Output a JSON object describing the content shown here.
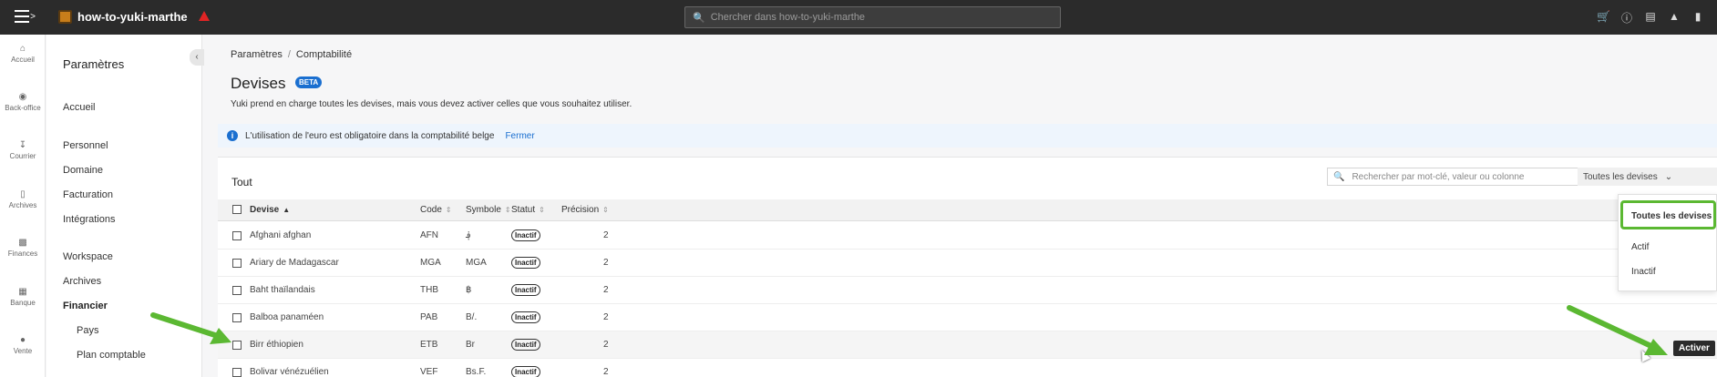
{
  "topbar": {
    "app_name": "how-to-yuki-marthe",
    "search_placeholder": "Chercher dans how-to-yuki-marthe",
    "icons": [
      "cart-icon",
      "info-icon",
      "gift-icon",
      "megaphone-icon",
      "bookmark-icon"
    ],
    "cart_color": "#f08c1a"
  },
  "rail": {
    "items": [
      {
        "label": "Accueil",
        "icon": "home-icon"
      },
      {
        "label": "Back-office",
        "icon": "back-office-icon"
      },
      {
        "label": "Courrier",
        "icon": "inbox-icon"
      },
      {
        "label": "Archives",
        "icon": "archive-icon"
      },
      {
        "label": "Finances",
        "icon": "chart-icon"
      },
      {
        "label": "Banque",
        "icon": "bank-icon"
      },
      {
        "label": "Vente",
        "icon": "sale-icon"
      }
    ]
  },
  "sidebar": {
    "title": "Paramètres",
    "items": [
      {
        "label": "Accueil"
      },
      {
        "label": "Personnel"
      },
      {
        "label": "Domaine"
      },
      {
        "label": "Facturation"
      },
      {
        "label": "Intégrations"
      },
      {
        "label": "Workspace"
      },
      {
        "label": "Archives"
      },
      {
        "label": "Financier"
      },
      {
        "label": "Pays"
      },
      {
        "label": "Plan comptable"
      }
    ]
  },
  "breadcrumb": {
    "first": "Paramètres",
    "separator": "/",
    "second": "Comptabilité"
  },
  "page": {
    "title": "Devises",
    "badge": "BETA",
    "description": "Yuki prend en charge toutes les devises, mais vous devez activer celles que vous souhaitez utiliser."
  },
  "info": {
    "text": "L'utilisation de l'euro est obligatoire dans la comptabilité belge",
    "close": "Fermer",
    "accent": "#1a6fd0"
  },
  "table": {
    "title": "Tout",
    "search_placeholder": "Rechercher par mot-clé, valeur ou colonne",
    "filter_value": "Toutes les devises",
    "columns": {
      "devise": "Devise",
      "code": "Code",
      "symbole": "Symbole",
      "statut": "Statut",
      "precision": "Précision"
    },
    "rows": [
      {
        "devise": "Afghani afghan",
        "code": "AFN",
        "symbole": "؋",
        "statut": "Inactif",
        "precision": "2"
      },
      {
        "devise": "Ariary de Madagascar",
        "code": "MGA",
        "symbole": "MGA",
        "statut": "Inactif",
        "precision": "2"
      },
      {
        "devise": "Baht thaïlandais",
        "code": "THB",
        "symbole": "฿",
        "statut": "Inactif",
        "precision": "2"
      },
      {
        "devise": "Balboa panaméen",
        "code": "PAB",
        "symbole": "B/.",
        "statut": "Inactif",
        "precision": "2"
      },
      {
        "devise": "Birr éthiopien",
        "code": "ETB",
        "symbole": "Br",
        "statut": "Inactif",
        "precision": "2"
      },
      {
        "devise": "Bolivar vénézuélien",
        "code": "VEF",
        "symbole": "Bs.F.",
        "statut": "Inactif",
        "precision": "2"
      }
    ]
  },
  "dropdown": {
    "options": [
      "Toutes les devises",
      "Actif",
      "Inactif"
    ],
    "highlight_color": "#5bb832"
  },
  "action": {
    "activate_label": "Activer"
  }
}
